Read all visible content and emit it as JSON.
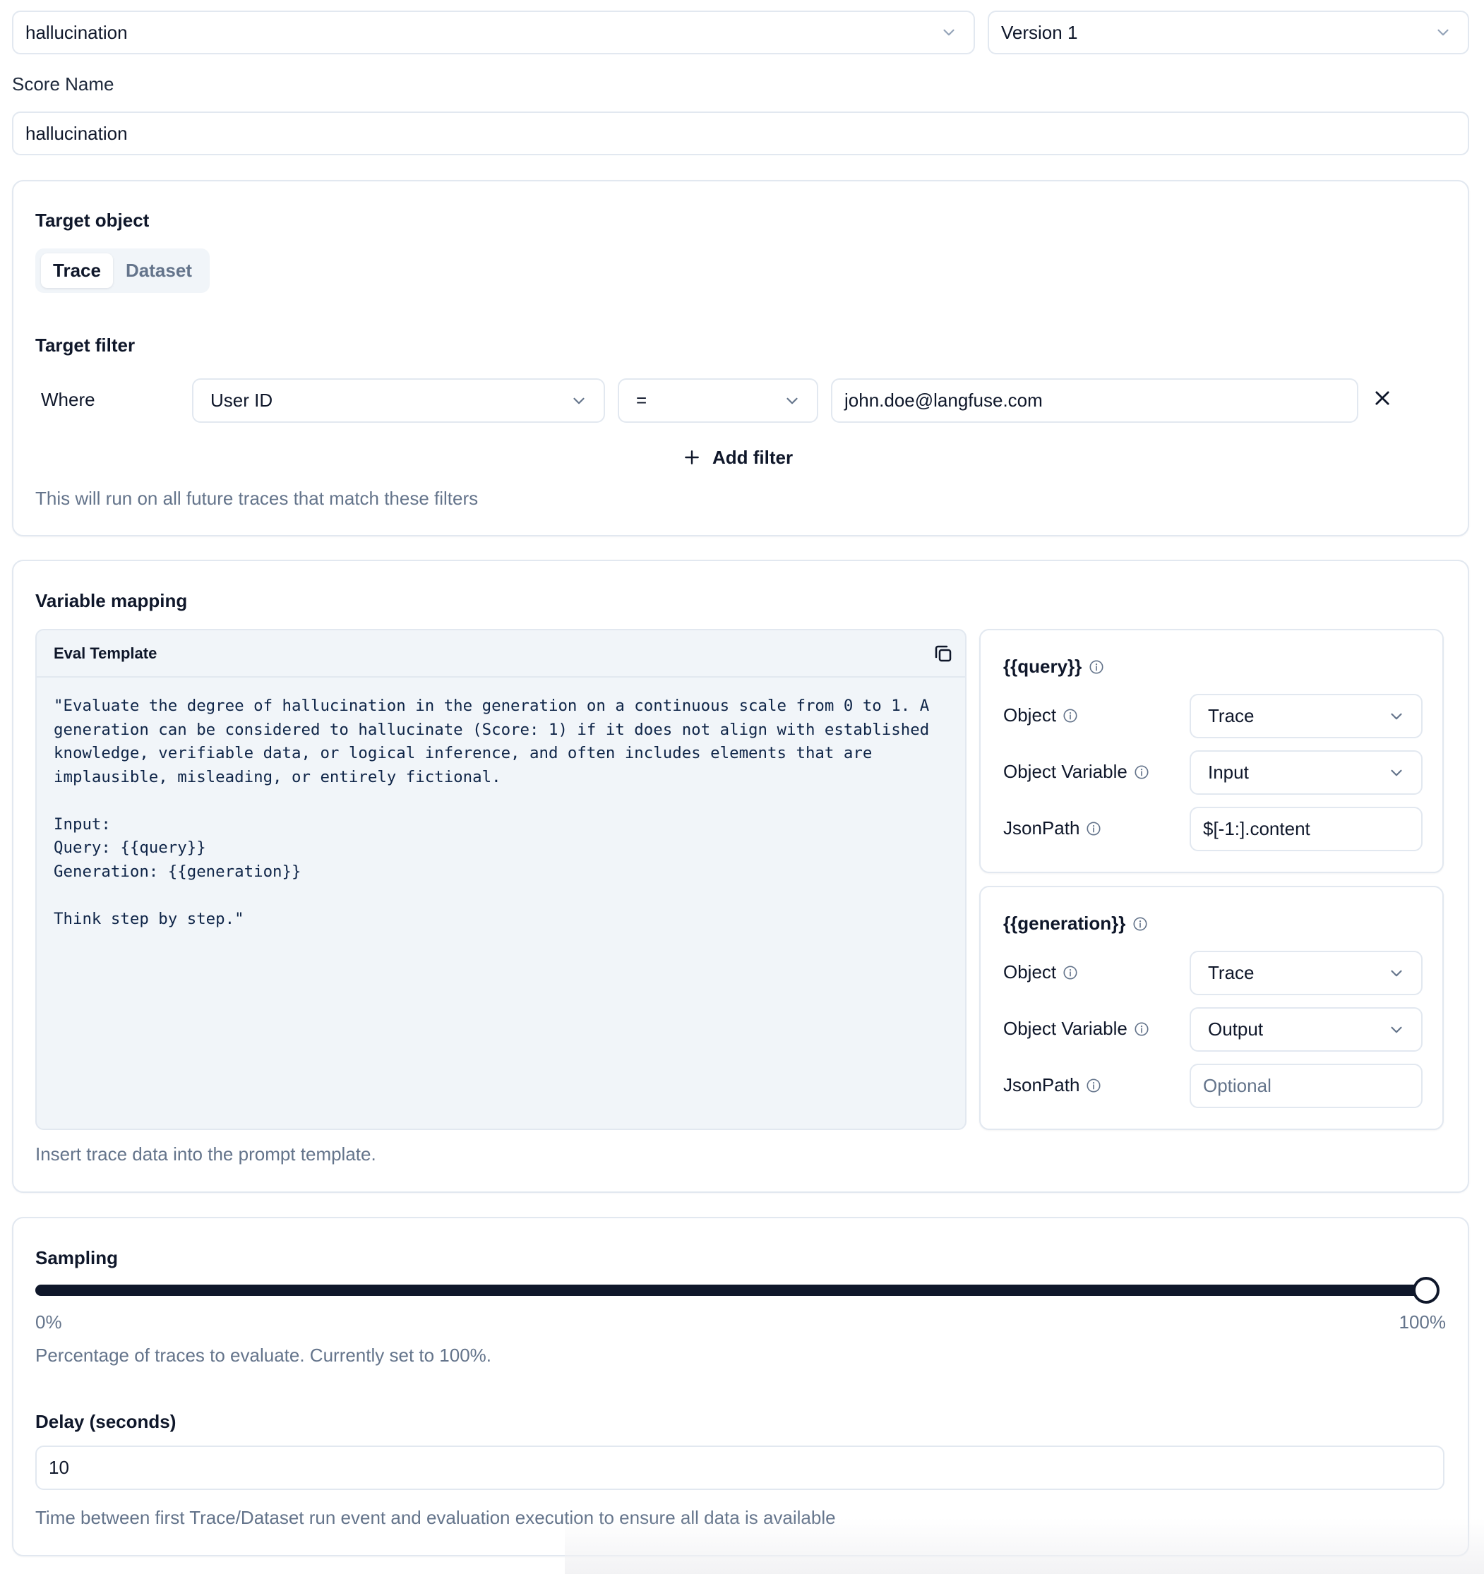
{
  "header": {
    "template_select": {
      "value": "hallucination",
      "icon": "chevron-down-icon"
    },
    "version_select": {
      "value": "Version 1",
      "icon": "chevron-down-icon"
    }
  },
  "score_name": {
    "label": "Score Name",
    "value": "hallucination"
  },
  "target": {
    "object_label": "Target object",
    "tabs": [
      {
        "label": "Trace",
        "active": true
      },
      {
        "label": "Dataset",
        "active": false
      }
    ],
    "filter_label": "Target filter",
    "filter": {
      "where_label": "Where",
      "column": "User ID",
      "operator": "=",
      "value": "john.doe@langfuse.com"
    },
    "add_filter_label": "Add filter",
    "helper": "This will run on all future traces that match these filters"
  },
  "variable_mapping": {
    "title": "Variable mapping",
    "template": {
      "title": "Eval Template",
      "body": "\"Evaluate the degree of hallucination in the generation on a continuous scale from 0 to 1. A\ngeneration can be considered to hallucinate (Score: 1) if it does not align with established\nknowledge, verifiable data, or logical inference, and often includes elements that are\nimplausible, misleading, or entirely fictional.\n\nInput:\nQuery: {{query}}\nGeneration: {{generation}}\n\nThink step by step.\""
    },
    "variables": [
      {
        "name": "{{query}}",
        "object_label": "Object",
        "object_value": "Trace",
        "object_variable_label": "Object Variable",
        "object_variable_value": "Input",
        "jsonpath_label": "JsonPath",
        "jsonpath_value": "$[-1:].content",
        "jsonpath_placeholder": "Optional"
      },
      {
        "name": "{{generation}}",
        "object_label": "Object",
        "object_value": "Trace",
        "object_variable_label": "Object Variable",
        "object_variable_value": "Output",
        "jsonpath_label": "JsonPath",
        "jsonpath_value": "",
        "jsonpath_placeholder": "Optional"
      }
    ],
    "helper": "Insert trace data into the prompt template."
  },
  "sampling": {
    "title": "Sampling",
    "value_percent": 100,
    "min_label": "0%",
    "max_label": "100%",
    "helper": "Percentage of traces to evaluate. Currently set to 100%."
  },
  "delay": {
    "label": "Delay (seconds)",
    "value": "10",
    "helper": "Time between first Trace/Dataset run event and evaluation execution to ensure all data is available"
  },
  "colors": {
    "primary": "#0f172a",
    "muted": "#64748b",
    "border": "#e2e8f0",
    "subtle_bg": "#f1f5f9"
  }
}
